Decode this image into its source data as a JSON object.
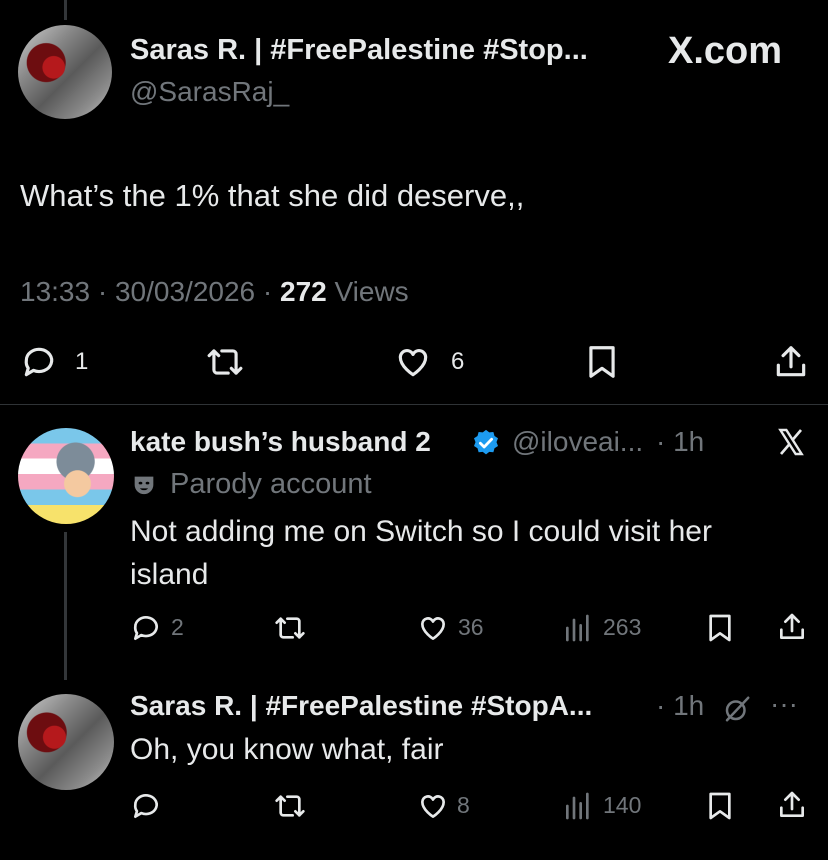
{
  "watermark": "X.com",
  "main_tweet": {
    "author_name": "Saras R. | #FreePalestine #Stop...",
    "handle": "@SarasRaj_",
    "text": "What’s the 1% that she did deserve,,",
    "time": "13:33",
    "date": "30/03/2026",
    "views_count": "272",
    "views_label": "Views",
    "separator": "·",
    "replies": "1",
    "likes": "6"
  },
  "reply1": {
    "author_name": "kate bush’s husband 2",
    "handle": "@iloveai...",
    "time": "· 1h",
    "label": "Parody account",
    "text": "Not adding me on Switch so I could visit her island",
    "replies": "2",
    "likes": "36",
    "views": "263"
  },
  "reply2": {
    "author_name": "Saras R. | #FreePalestine #StopA...",
    "time": "· 1h",
    "more": "···",
    "text": "Oh, you know what, fair",
    "likes": "8",
    "views": "140"
  },
  "colors": {
    "background": "#000000",
    "text": "#e7e9ea",
    "muted": "#71767b",
    "verified": "#1d9bf0"
  },
  "icons": [
    "reply-icon",
    "retweet-icon",
    "like-icon",
    "bookmark-icon",
    "share-icon",
    "views-icon",
    "verified-badge-icon",
    "x-logo-icon",
    "parody-mask-icon",
    "grok-icon"
  ]
}
